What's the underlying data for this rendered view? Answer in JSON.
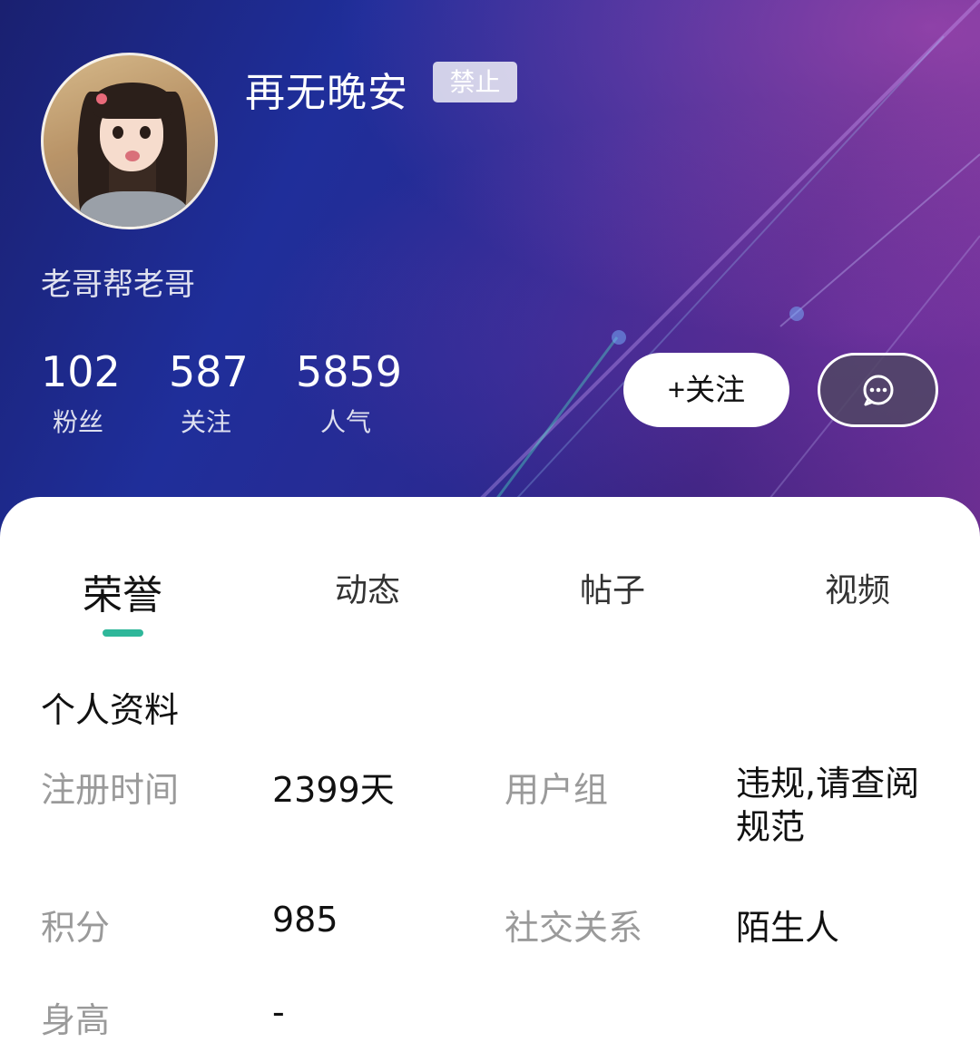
{
  "profile": {
    "username": "再无晚安",
    "badge": "禁止",
    "signature": "老哥帮老哥",
    "stats": [
      {
        "value": "102",
        "label": "粉丝"
      },
      {
        "value": "587",
        "label": "关注"
      },
      {
        "value": "5859",
        "label": "人气"
      }
    ],
    "follow_label": "+关注",
    "message_icon": "chat-bubble-icon"
  },
  "tabs": [
    {
      "label": "荣誉",
      "active": true
    },
    {
      "label": "动态",
      "active": false
    },
    {
      "label": "帖子",
      "active": false
    },
    {
      "label": "视频",
      "active": false
    }
  ],
  "info": {
    "title": "个人资料",
    "fields": [
      {
        "key": "注册时间",
        "value": "2399天"
      },
      {
        "key": "用户组",
        "value": "违规,请查阅规范"
      },
      {
        "key": "积分",
        "value": "985"
      },
      {
        "key": "社交关系",
        "value": "陌生人"
      },
      {
        "key": "身高",
        "value": "-"
      }
    ]
  },
  "colors": {
    "accent": "#2fb79a",
    "header_start": "#1a2070",
    "header_end": "#6b2d8f"
  }
}
